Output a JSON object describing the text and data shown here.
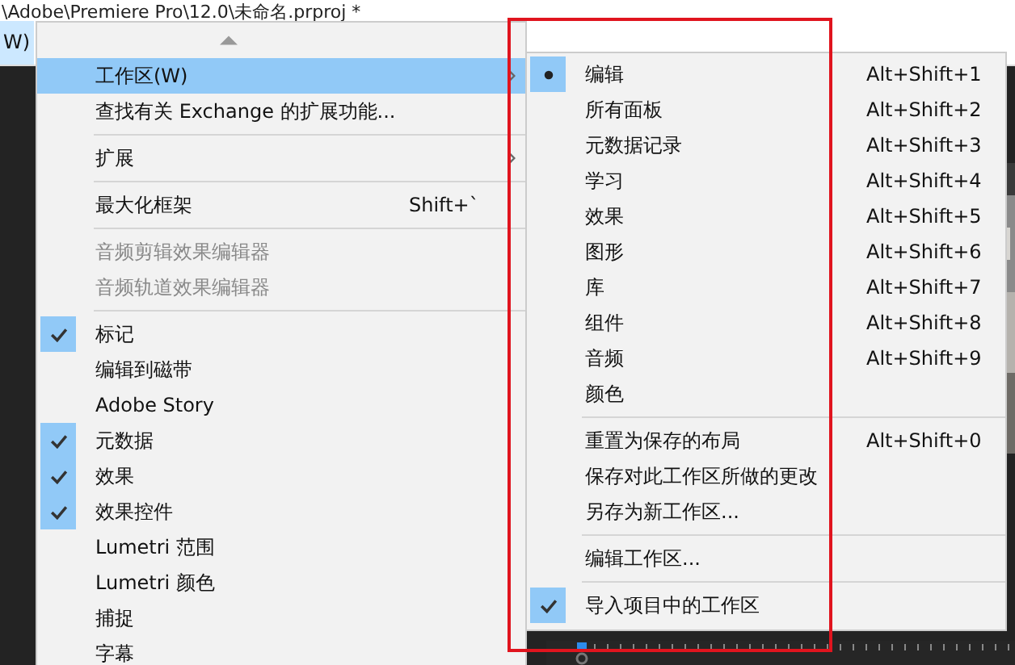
{
  "title_bar": {
    "title": "\\Adobe\\Premiere Pro\\12.0\\未命名.prproj *"
  },
  "menu_bar": {
    "items": [
      {
        "label": "W)",
        "selected": true
      }
    ]
  },
  "menu": {
    "items": [
      {
        "kind": "item",
        "label": "工作区(W)",
        "selected": true,
        "checked": false,
        "disabled": false,
        "submenu": true
      },
      {
        "kind": "item",
        "label": "查找有关 Exchange 的扩展功能...",
        "selected": false,
        "checked": false,
        "disabled": false,
        "submenu": false
      },
      {
        "kind": "separator"
      },
      {
        "kind": "item",
        "label": "扩展",
        "selected": false,
        "checked": false,
        "disabled": false,
        "submenu": true
      },
      {
        "kind": "separator"
      },
      {
        "kind": "item",
        "label": "最大化框架",
        "shortcut": "Shift+`",
        "selected": false,
        "checked": false,
        "disabled": false,
        "submenu": false
      },
      {
        "kind": "separator"
      },
      {
        "kind": "item",
        "label": "音频剪辑效果编辑器",
        "selected": false,
        "checked": false,
        "disabled": true,
        "submenu": false
      },
      {
        "kind": "item",
        "label": "音频轨道效果编辑器",
        "selected": false,
        "checked": false,
        "disabled": true,
        "submenu": false
      },
      {
        "kind": "separator"
      },
      {
        "kind": "item",
        "label": "标记",
        "selected": false,
        "checked": true,
        "disabled": false,
        "submenu": false
      },
      {
        "kind": "item",
        "label": "编辑到磁带",
        "selected": false,
        "checked": false,
        "disabled": false,
        "submenu": false
      },
      {
        "kind": "item",
        "label": "Adobe Story",
        "selected": false,
        "checked": false,
        "disabled": false,
        "submenu": false
      },
      {
        "kind": "item",
        "label": "元数据",
        "selected": false,
        "checked": true,
        "disabled": false,
        "submenu": false
      },
      {
        "kind": "item",
        "label": "效果",
        "selected": false,
        "checked": true,
        "disabled": false,
        "submenu": false
      },
      {
        "kind": "item",
        "label": "效果控件",
        "selected": false,
        "checked": true,
        "disabled": false,
        "submenu": false
      },
      {
        "kind": "item",
        "label": "Lumetri 范围",
        "selected": false,
        "checked": false,
        "disabled": false,
        "submenu": false
      },
      {
        "kind": "item",
        "label": "Lumetri 颜色",
        "selected": false,
        "checked": false,
        "disabled": false,
        "submenu": false
      },
      {
        "kind": "item",
        "label": "捕捉",
        "selected": false,
        "checked": false,
        "disabled": false,
        "submenu": false
      },
      {
        "kind": "item",
        "label": "字幕",
        "selected": false,
        "checked": false,
        "disabled": false,
        "submenu": false
      }
    ]
  },
  "submenu": {
    "items": [
      {
        "kind": "radio",
        "label": "编辑",
        "shortcut": "Alt+Shift+1",
        "selected": true
      },
      {
        "kind": "radio",
        "label": "所有面板",
        "shortcut": "Alt+Shift+2",
        "selected": false
      },
      {
        "kind": "radio",
        "label": "元数据记录",
        "shortcut": "Alt+Shift+3",
        "selected": false
      },
      {
        "kind": "radio",
        "label": "学习",
        "shortcut": "Alt+Shift+4",
        "selected": false
      },
      {
        "kind": "radio",
        "label": "效果",
        "shortcut": "Alt+Shift+5",
        "selected": false
      },
      {
        "kind": "radio",
        "label": "图形",
        "shortcut": "Alt+Shift+6",
        "selected": false
      },
      {
        "kind": "radio",
        "label": "库",
        "shortcut": "Alt+Shift+7",
        "selected": false
      },
      {
        "kind": "radio",
        "label": "组件",
        "shortcut": "Alt+Shift+8",
        "selected": false
      },
      {
        "kind": "radio",
        "label": "音频",
        "shortcut": "Alt+Shift+9",
        "selected": false
      },
      {
        "kind": "radio",
        "label": "颜色",
        "selected": false
      },
      {
        "kind": "separator"
      },
      {
        "kind": "command",
        "label": "重置为保存的布局",
        "shortcut": "Alt+Shift+0"
      },
      {
        "kind": "command",
        "label": "保存对此工作区所做的更改"
      },
      {
        "kind": "command",
        "label": "另存为新工作区..."
      },
      {
        "kind": "separator"
      },
      {
        "kind": "command",
        "label": "编辑工作区..."
      },
      {
        "kind": "separator"
      },
      {
        "kind": "check",
        "label": "导入项目中的工作区",
        "checked": true
      }
    ]
  }
}
